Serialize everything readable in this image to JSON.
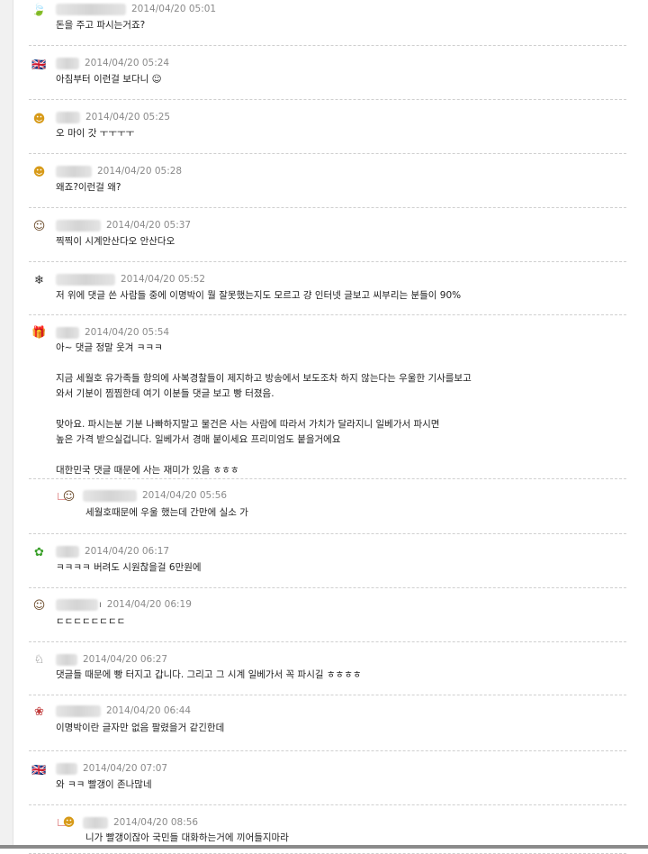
{
  "comments": [
    {
      "icon": "leaf-icon",
      "glyph": "🍃",
      "color": "#3a9a2a",
      "time": "2014/04/20 05:01",
      "lines": [
        "돈을 주고 파시는거죠?"
      ]
    },
    {
      "icon": "uk-flag-icon",
      "glyph": "🇬🇧",
      "color": "#223f8a",
      "time": "2014/04/20 05:24",
      "lines": [
        "아침부터 이런걸 보다니 ☺"
      ]
    },
    {
      "icon": "yellow-face-icon",
      "glyph": "☻",
      "color": "#d79a18",
      "time": "2014/04/20 05:25",
      "lines": [
        "오 마이 갓 ㅜㅜㅜㅜ"
      ]
    },
    {
      "icon": "yellow-face-icon",
      "glyph": "☻",
      "color": "#d79a18",
      "time": "2014/04/20 05:28",
      "lines": [
        "왜죠?이런걸 왜?"
      ]
    },
    {
      "icon": "glasses-face-icon",
      "glyph": "☺",
      "color": "#6b4a2a",
      "time": "2014/04/20 05:37",
      "lines": [
        "찍찍이 시계안산다오 안산다오"
      ]
    },
    {
      "icon": "snowflake-icon",
      "glyph": "❄",
      "color": "#333333",
      "time": "2014/04/20 05:52",
      "lines": [
        "저 위에 댓글 쓴 사람들 중에 이명박이 뭘 잘못했는지도 모르고 걍 인터넷 글보고 씨부리는 분들이 90%"
      ]
    },
    {
      "icon": "gift-icon",
      "glyph": "🎁",
      "color": "#b03030",
      "time": "2014/04/20 05:54",
      "lines": [
        "아~ 댓글 정말 웃겨 ㅋㅋㅋ",
        "",
        "지금 세월호 유가족들 항의에 사복경찰들이 제지하고 방송에서 보도조차 하지 않는다는 우울한 기사를보고",
        "와서 기분이 찜찜한데 여기 이분들 댓글 보고 빵 터졌음.",
        "",
        "맞아요. 파시는분 기분 나빠하지말고 물건은 사는 사람에 따라서 가치가 달라지니 일베가서 파시면",
        "높은 가격 받으실겁니다. 일베가서 경매 붙이세요 프리미엄도 붙을거에요",
        "",
        "대한민국 댓글 때문에 사는 재미가 있음 ㅎㅎㅎ"
      ]
    },
    {
      "icon": "glasses-face-icon",
      "glyph": "☺",
      "color": "#6b4a2a",
      "time": "2014/04/20 05:56",
      "reply": true,
      "lines": [
        "세월호때문에 우울 했는데 간만에 실소 가"
      ]
    },
    {
      "icon": "green-character-icon",
      "glyph": "✿",
      "color": "#3aa02a",
      "time": "2014/04/20 06:17",
      "lines": [
        "ㅋㅋㅋㅋ 버려도 시원찮을걸 6만원에"
      ]
    },
    {
      "icon": "glasses-face-icon",
      "glyph": "☺",
      "color": "#6b4a2a",
      "time": "2014/04/20 06:19",
      "suffix": "ı",
      "lines": [
        "ㄷㄷㄷㄷㄷㄷㄷㄷ"
      ]
    },
    {
      "icon": "sheep-icon",
      "glyph": "♘",
      "color": "#666666",
      "time": "2014/04/20 06:27",
      "lines": [
        "댓글들 때문에 빵 터지고 갑니다. 그리고 그 시계 일베가서 꼭 파시길 ㅎㅎㅎㅎ"
      ]
    },
    {
      "icon": "flower-pot-icon",
      "glyph": "❀",
      "color": "#c03a3a",
      "time": "2014/04/20 06:44",
      "lines": [
        "이명박이란 글자만 없음 팔렸을거 같긴한데"
      ]
    },
    {
      "icon": "uk-flag-icon",
      "glyph": "🇬🇧",
      "color": "#223f8a",
      "time": "2014/04/20 07:07",
      "lines": [
        "와 ㅋㅋ 빨갱이 존나많네"
      ]
    },
    {
      "icon": "yellow-face-icon",
      "glyph": "☻",
      "color": "#d79a18",
      "time": "2014/04/20 08:56",
      "reply": true,
      "lines": [
        "니가 빨갱이잖아 국민들 대화하는거에 끼어들지마라"
      ]
    }
  ]
}
